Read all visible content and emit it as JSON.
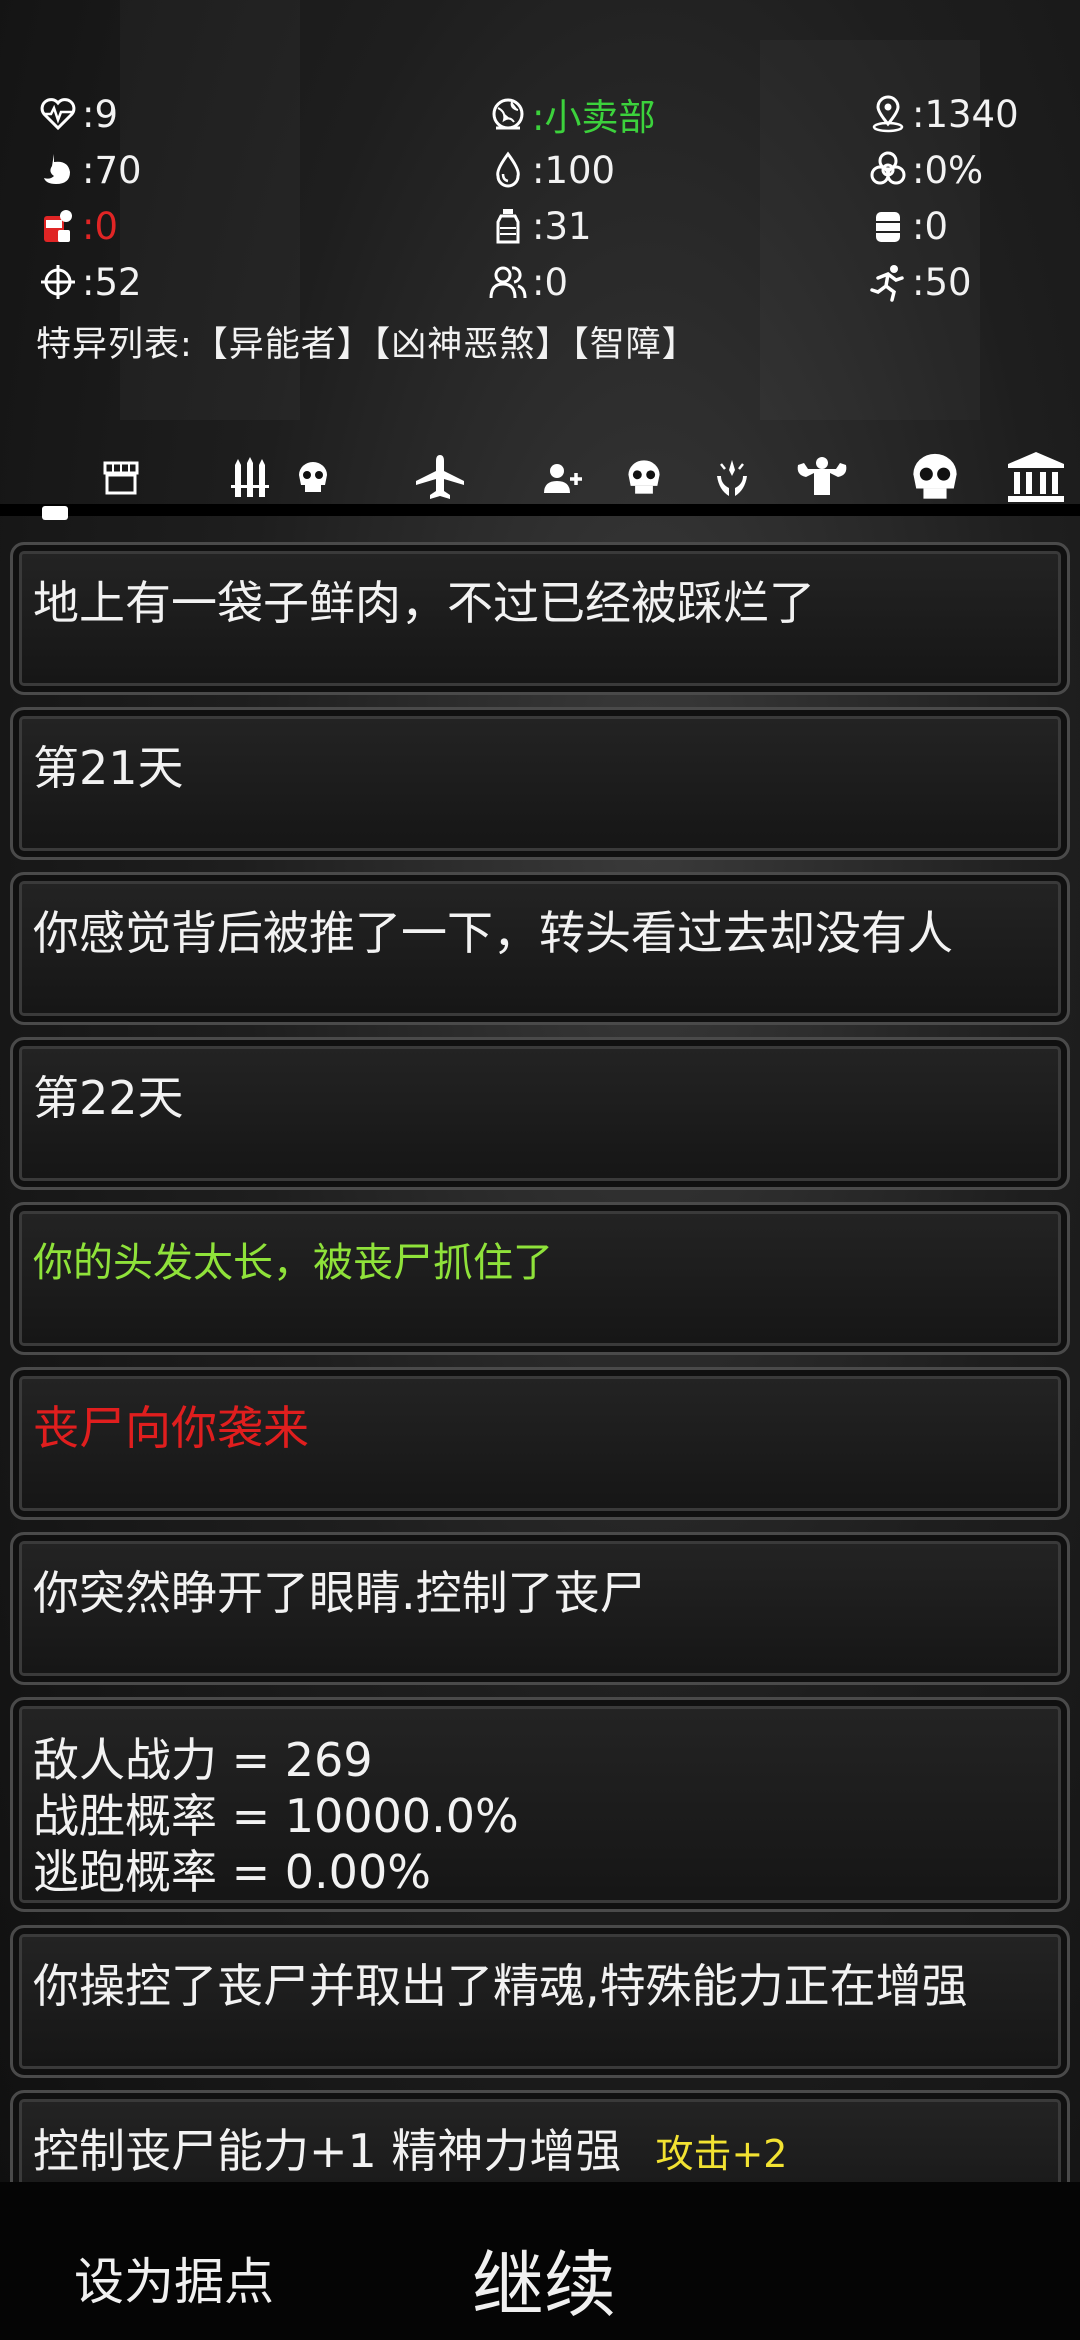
{
  "stats": [
    [
      {
        "icon": "heart-pulse-icon",
        "value": ":9",
        "color": "#f2f2f2"
      },
      {
        "icon": "globe-icon",
        "value": ":小卖部",
        "color": "#3cd23c"
      },
      {
        "icon": "location-pin-icon",
        "value": ":1340",
        "color": "#f2f2f2"
      }
    ],
    [
      {
        "icon": "stomach-icon",
        "value": ":70",
        "color": "#f2f2f2"
      },
      {
        "icon": "water-drop-icon",
        "value": ":100",
        "color": "#f2f2f2"
      },
      {
        "icon": "biohazard-icon",
        "value": ":0%",
        "color": "#f2f2f2"
      }
    ],
    [
      {
        "icon": "food-can-icon",
        "value": ":0",
        "color": "#e02525"
      },
      {
        "icon": "bottle-icon",
        "value": ":31",
        "color": "#f2f2f2"
      },
      {
        "icon": "barrel-icon",
        "value": ":0",
        "color": "#f2f2f2"
      }
    ],
    [
      {
        "icon": "crosshair-icon",
        "value": ":52",
        "color": "#f2f2f2"
      },
      {
        "icon": "people-icon",
        "value": ":0",
        "color": "#f2f2f2"
      },
      {
        "icon": "running-icon",
        "value": ":50",
        "color": "#f2f2f2"
      }
    ]
  ],
  "traits": "特异列表:【异能者】【凶神恶煞】【智障】",
  "tabs": [
    {
      "icon": "shop-icon"
    },
    {
      "icon": "weapons-icon"
    },
    {
      "icon": "skull-icon"
    },
    {
      "icon": "airplane-icon"
    },
    {
      "icon": "add-person-icon"
    },
    {
      "icon": "skull-icon"
    },
    {
      "icon": "hands-light-icon"
    },
    {
      "icon": "muscle-icon"
    },
    {
      "icon": "skull-large-icon"
    },
    {
      "icon": "bank-icon"
    }
  ],
  "log": [
    {
      "text": "地上有一袋子鲜肉，不过已经被踩烂了",
      "color": "#f2f2f2"
    },
    {
      "text": "第21天",
      "color": "#f2f2f2"
    },
    {
      "text": "你感觉背后被推了一下，转头看过去却没有人",
      "color": "#f2f2f2"
    },
    {
      "text": "第22天",
      "color": "#f2f2f2"
    },
    {
      "text": "你的头发太长，被丧尸抓住了",
      "color": "#8fe23a"
    },
    {
      "text": "丧尸向你袭来",
      "color": "#e01e1e"
    },
    {
      "text": "你突然睁开了眼睛.控制了丧尸",
      "color": "#f2f2f2"
    },
    {
      "text": "敌人战力 = 269\n战胜概率 = 10000.0%\n逃跑概率 = 0.00%",
      "color": "#f2f2f2"
    },
    {
      "text": "你操控了丧尸并取出了精魂,特殊能力正在增强",
      "color": "#f2f2f2"
    },
    {
      "text": "控制丧尸能力+1 精神力增强",
      "extra": "攻击+2",
      "color": "#f2f2f2"
    }
  ],
  "buttons": {
    "set_base": "设为据点",
    "continue": "继续"
  }
}
